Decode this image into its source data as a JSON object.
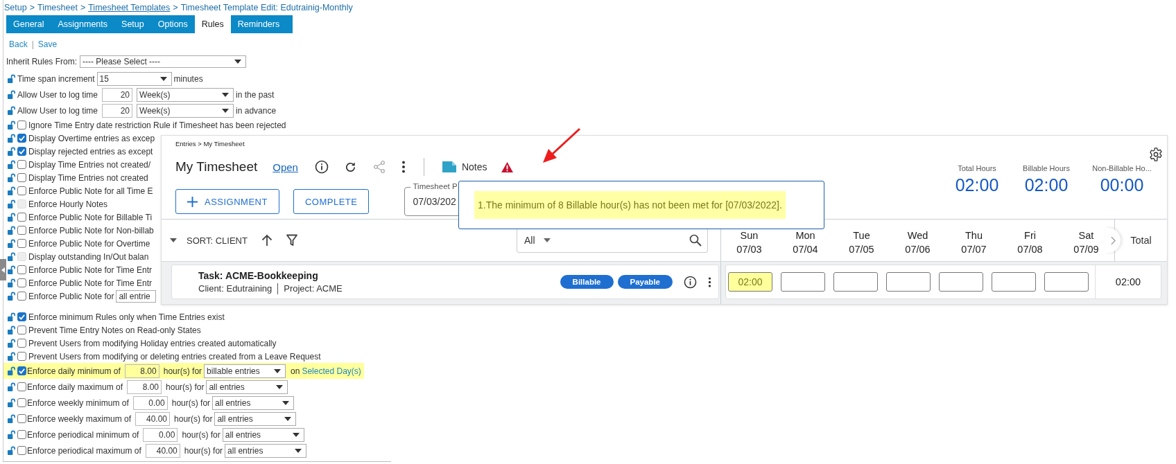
{
  "settings": {
    "breadcrumb": {
      "separator": ">",
      "parts": [
        {
          "text": "Setup",
          "link": false
        },
        {
          "text": "Timesheet",
          "link": false
        },
        {
          "text": "Timesheet Templates",
          "link": true
        },
        {
          "text": "Timesheet Template Edit: Edutrainig-Monthly",
          "link": false
        }
      ]
    },
    "tabs": [
      {
        "label": "General",
        "selected": false
      },
      {
        "label": "Assignments",
        "selected": false
      },
      {
        "label": "Setup",
        "selected": false
      },
      {
        "label": "Options",
        "selected": false
      },
      {
        "label": "Rules",
        "selected": true
      },
      {
        "label": "Reminders",
        "selected": false
      }
    ],
    "actions": {
      "items": [
        "Back",
        "Save"
      ],
      "separator": "|"
    },
    "inherit": {
      "label": "Inherit Rules From:",
      "value": "---- Please Select ----"
    },
    "rules": [
      {
        "kind": "select",
        "label": "Time span increment",
        "value": "15",
        "suffix": "minutes"
      },
      {
        "kind": "amount",
        "label": "Allow User to log time",
        "amount": "20",
        "value": "Week(s)",
        "suffix": "in the past"
      },
      {
        "kind": "amount",
        "label": "Allow User to log time",
        "amount": "20",
        "value": "Week(s)",
        "suffix": "in advance"
      },
      {
        "kind": "check",
        "label": "Ignore Time Entry date restriction Rule if Timesheet has been rejected",
        "checked": false,
        "disabled": false
      },
      {
        "kind": "check",
        "label": "Display Overtime entries as excep",
        "checked": true,
        "disabled": false
      },
      {
        "kind": "check",
        "label": "Display rejected entries as except",
        "checked": true,
        "disabled": false
      },
      {
        "kind": "check",
        "label": "Display Time Entries not created/",
        "checked": false,
        "disabled": false
      },
      {
        "kind": "check",
        "label": "Display Time Entries not created",
        "checked": false,
        "disabled": false
      },
      {
        "kind": "check",
        "label": "Enforce Public Note for all Time E",
        "checked": false,
        "disabled": false
      },
      {
        "kind": "check",
        "label": "Enforce Hourly Notes",
        "checked": false,
        "disabled": true
      },
      {
        "kind": "check",
        "label": "Enforce Public Note for Billable Ti",
        "checked": false,
        "disabled": false
      },
      {
        "kind": "check",
        "label": "Enforce Public Note for Non-billab",
        "checked": false,
        "disabled": false
      },
      {
        "kind": "check",
        "label": "Enforce Public Note for Overtime",
        "checked": false,
        "disabled": false
      },
      {
        "kind": "check",
        "label": "Display outstanding In/Out balan",
        "checked": false,
        "disabled": true
      },
      {
        "kind": "check",
        "label": "Enforce Public Note for Time Entr",
        "checked": false,
        "disabled": false
      },
      {
        "kind": "check",
        "label": "Enforce Public Note for Time Entr",
        "checked": false,
        "disabled": false
      },
      {
        "kind": "check_select",
        "label": "Enforce Public Note for",
        "value": "all entrie",
        "checked": false,
        "disabled": false
      }
    ],
    "minimum_rules": [
      {
        "kind": "check",
        "label": "Enforce minimum Rules only when Time Entries exist",
        "checked": true,
        "disabled": false
      },
      {
        "kind": "check",
        "label": "Prevent Time Entry Notes on Read-only States",
        "checked": false,
        "disabled": false
      },
      {
        "kind": "check",
        "label": "Prevent Users from modifying Holiday entries created automatically",
        "checked": false,
        "disabled": false
      },
      {
        "kind": "check",
        "label": "Prevent Users from modifying or deleting entries created from a Leave Request",
        "checked": false,
        "disabled": false
      },
      {
        "kind": "limit",
        "label": "Enforce daily minimum of",
        "checked": true,
        "highlighted": true,
        "amount": "8.00",
        "middle": "hour(s) for",
        "value": "billable entries",
        "after": "on",
        "link": "Selected Day(s)"
      },
      {
        "kind": "limit",
        "label": "Enforce daily maximum of",
        "checked": false,
        "highlighted": false,
        "amount": "8.00",
        "middle": "hour(s) for",
        "value": "all entries"
      },
      {
        "kind": "limit",
        "label": "Enforce weekly minimum of",
        "checked": false,
        "highlighted": false,
        "amount": "0.00",
        "middle": "hour(s) for",
        "value": "all entries"
      },
      {
        "kind": "limit",
        "label": "Enforce weekly maximum of",
        "checked": false,
        "highlighted": false,
        "amount": "40.00",
        "middle": "hour(s) for",
        "value": "all entries"
      },
      {
        "kind": "limit",
        "label": "Enforce periodical minimum of",
        "checked": false,
        "highlighted": false,
        "amount": "0.00",
        "middle": "hour(s) for",
        "value": "all entries"
      },
      {
        "kind": "limit",
        "label": "Enforce periodical maximum of",
        "checked": false,
        "highlighted": false,
        "amount": "40.00",
        "middle": "hour(s) for",
        "value": "all entries"
      }
    ]
  },
  "timesheet": {
    "breadcrumb": "Entries > My Timesheet",
    "title": "My Timesheet",
    "status": "Open",
    "notes": "Notes",
    "add_button": "ASSIGNMENT",
    "complete_button": "COMPLETE",
    "period": {
      "label": "Timesheet P",
      "value": "07/03/202"
    },
    "totals": [
      {
        "label": "Total Hours",
        "value": "02:00"
      },
      {
        "label": "Billable Hours",
        "value": "02:00"
      },
      {
        "label": "Non-Billable Ho...",
        "value": "00:00"
      }
    ],
    "sort": "SORT: CLIENT",
    "view_filter": "All",
    "days": [
      {
        "day": "Sun",
        "date": "07/03"
      },
      {
        "day": "Mon",
        "date": "07/04"
      },
      {
        "day": "Tue",
        "date": "07/05"
      },
      {
        "day": "Wed",
        "date": "07/06"
      },
      {
        "day": "Thu",
        "date": "07/07"
      },
      {
        "day": "Fri",
        "date": "07/08"
      },
      {
        "day": "Sat",
        "date": "07/09"
      }
    ],
    "total_heading": "Total",
    "rows": [
      {
        "task": "Task: ACME-Bookkeeping",
        "client": "Client: Edutraining",
        "project": "Project: ACME",
        "tags": [
          "Billable",
          "Payable"
        ],
        "entries": [
          {
            "value": "02:00",
            "highlighted": true
          },
          {
            "highlighted": false
          },
          {
            "highlighted": false
          },
          {
            "highlighted": false
          },
          {
            "highlighted": false
          },
          {
            "highlighted": false
          },
          {
            "highlighted": false
          }
        ],
        "total": "02:00"
      }
    ],
    "alert": {
      "message": "1.The minimum of 8 Billable hour(s) has not been met for [07/03/2022].",
      "highlighted": true
    }
  }
}
